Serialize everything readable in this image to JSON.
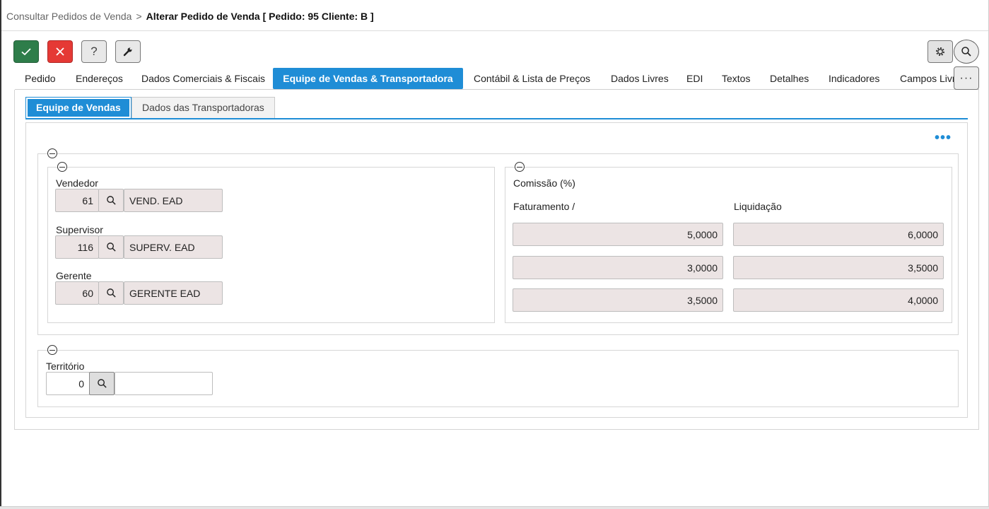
{
  "breadcrumb": {
    "parent": "Consultar Pedidos de Venda",
    "separator": ">",
    "current": "Alterar Pedido de Venda [ Pedido: 95 Cliente: B ]"
  },
  "toolbar": {
    "confirm_icon": "check-icon",
    "cancel_icon": "close-icon",
    "help_label": "?",
    "tools_icon": "wrench-icon",
    "settings_icon": "gear-icon",
    "search_icon": "search-icon"
  },
  "main_tabs": [
    {
      "label": "Pedido"
    },
    {
      "label": "Endereços"
    },
    {
      "label": "Dados Comerciais & Fiscais"
    },
    {
      "label": "Equipe de Vendas & Transportadora",
      "active": true
    },
    {
      "label": "Contábil & Lista de Preços"
    },
    {
      "label": "Dados Livres"
    },
    {
      "label": "EDI"
    },
    {
      "label": "Textos"
    },
    {
      "label": "Detalhes"
    },
    {
      "label": "Indicadores"
    },
    {
      "label": "Campos Livres"
    }
  ],
  "more_tabs_label": "···",
  "sub_tabs": [
    {
      "label": "Equipe de Vendas",
      "active": true
    },
    {
      "label": "Dados das Transportadoras"
    }
  ],
  "more_actions": "•••",
  "sales_team": {
    "vendedor": {
      "label": "Vendedor",
      "code": "61",
      "name": "VEND. EAD"
    },
    "supervisor": {
      "label": "Supervisor",
      "code": "116",
      "name": "SUPERV. EAD"
    },
    "gerente": {
      "label": "Gerente",
      "code": "60",
      "name": "GERENTE EAD"
    }
  },
  "commission": {
    "title": "Comissão (%)",
    "col_faturamento": "Faturamento /",
    "col_liquidacao": "Liquidação",
    "rows": [
      {
        "faturamento": "5,0000",
        "liquidacao": "6,0000"
      },
      {
        "faturamento": "3,0000",
        "liquidacao": "3,5000"
      },
      {
        "faturamento": "3,5000",
        "liquidacao": "4,0000"
      }
    ]
  },
  "territory": {
    "label": "Território",
    "code": "0",
    "name": ""
  },
  "colors": {
    "accent": "#1f8dd6",
    "confirm": "#2e7d4a",
    "cancel": "#e53935",
    "readonly_field": "#ece4e4"
  }
}
